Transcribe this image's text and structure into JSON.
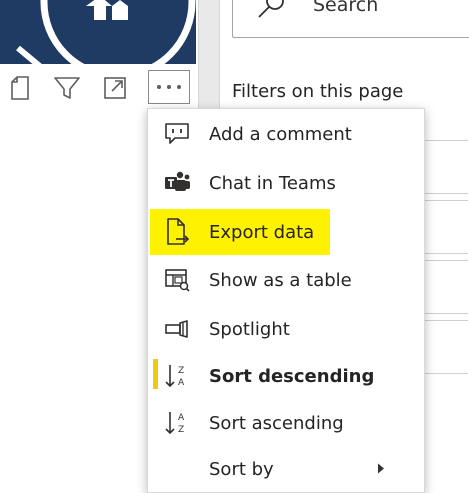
{
  "colors": {
    "visual_bg": "#1f3a63",
    "highlight": "#fff200",
    "active_indicator": "#f2c811",
    "text": "#252423"
  },
  "visual_toolbar": {
    "icons": [
      "copy-icon",
      "filter-icon",
      "focus-mode-icon",
      "more-options-icon"
    ]
  },
  "filter_pane": {
    "search": {
      "placeholder": "Search",
      "value": ""
    },
    "title": "Filters on this page"
  },
  "context_menu": {
    "items": [
      {
        "label": "Add a comment",
        "icon": "comment-icon"
      },
      {
        "label": "Chat in Teams",
        "icon": "teams-icon"
      },
      {
        "label": "Export data",
        "icon": "export-icon",
        "highlighted": true
      },
      {
        "label": "Show as a table",
        "icon": "table-icon"
      },
      {
        "label": "Spotlight",
        "icon": "spotlight-icon"
      },
      {
        "label": "Sort descending",
        "icon": "sort-descending-icon",
        "active": true
      },
      {
        "label": "Sort ascending",
        "icon": "sort-ascending-icon"
      },
      {
        "label": "Sort by",
        "icon": "",
        "submenu": true
      }
    ]
  }
}
